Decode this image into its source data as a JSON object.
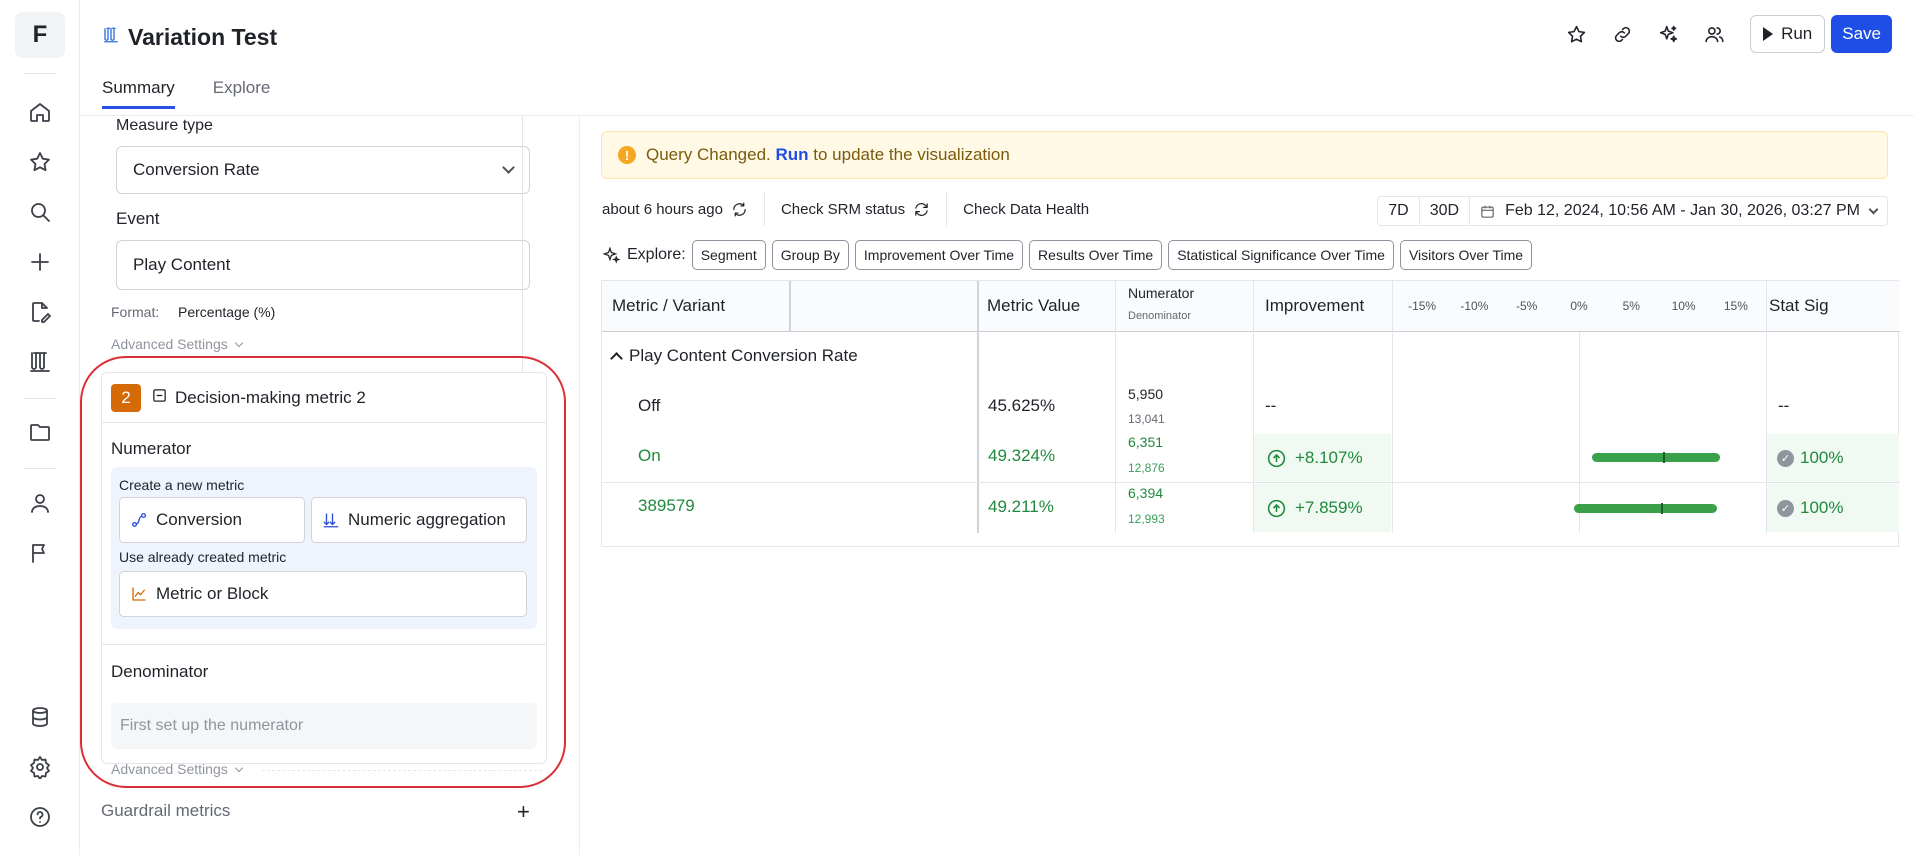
{
  "logo": "F",
  "header": {
    "title": "Variation Test",
    "tabs": [
      {
        "label": "Summary"
      },
      {
        "label": "Explore"
      }
    ],
    "run_label": "Run",
    "save_label": "Save"
  },
  "config": {
    "measure_type_label": "Measure type",
    "measure_type_value": "Conversion Rate",
    "event_label": "Event",
    "event_value": "Play Content",
    "format_label": "Format:",
    "format_value": "Percentage (%)",
    "advanced_settings": "Advanced Settings",
    "card": {
      "number": "2",
      "title": "Decision-making metric 2",
      "numerator_label": "Numerator",
      "create_new_label": "Create a new metric",
      "conversion_btn": "Conversion",
      "numeric_btn": "Numeric aggregation",
      "use_existing_label": "Use already created metric",
      "metric_block_btn": "Metric or Block",
      "denominator_label": "Denominator",
      "denominator_placeholder": "First set up the numerator",
      "advanced_settings": "Advanced Settings"
    },
    "guardrail_label": "Guardrail metrics"
  },
  "alert": {
    "prefix": "Query Changed.",
    "run_link": "Run",
    "suffix": "to update the visualization"
  },
  "toolbar": {
    "updated": "about 6 hours ago",
    "srm": "Check SRM status",
    "health": "Check Data Health",
    "range_7d": "7D",
    "range_30d": "30D",
    "date_range": "Feb 12, 2024, 10:56 AM - Jan 30, 2026, 03:27 PM"
  },
  "explore": {
    "label": "Explore:",
    "chips": [
      "Segment",
      "Group By",
      "Improvement Over Time",
      "Results Over Time",
      "Statistical Significance Over Time",
      "Visitors Over Time"
    ]
  },
  "table": {
    "headers": {
      "metric": "Metric / Variant",
      "value": "Metric Value",
      "numerator": "Numerator",
      "denominator": "Denominator",
      "improvement": "Improvement",
      "statsig": "Stat Sig"
    },
    "axis_ticks": [
      "-15%",
      "-10%",
      "-5%",
      "0%",
      "5%",
      "10%",
      "15%"
    ],
    "metric_name": "Play Content Conversion Rate",
    "rows": [
      {
        "variant": "Off",
        "value": "45.625%",
        "numerator": "5,950",
        "denominator": "13,041",
        "improvement": "--",
        "statsig": "--"
      },
      {
        "variant": "On",
        "value": "49.324%",
        "numerator": "6,351",
        "denominator": "12,876",
        "improvement": "+8.107%",
        "statsig": "100%",
        "ci_low": 1.2,
        "ci_high": 13.5,
        "point": 8.1
      },
      {
        "variant": "389579",
        "value": "49.211%",
        "numerator": "6,394",
        "denominator": "12,993",
        "improvement": "+7.859%",
        "statsig": "100%",
        "ci_low": -0.5,
        "ci_high": 13.2,
        "point": 7.9
      }
    ]
  }
}
